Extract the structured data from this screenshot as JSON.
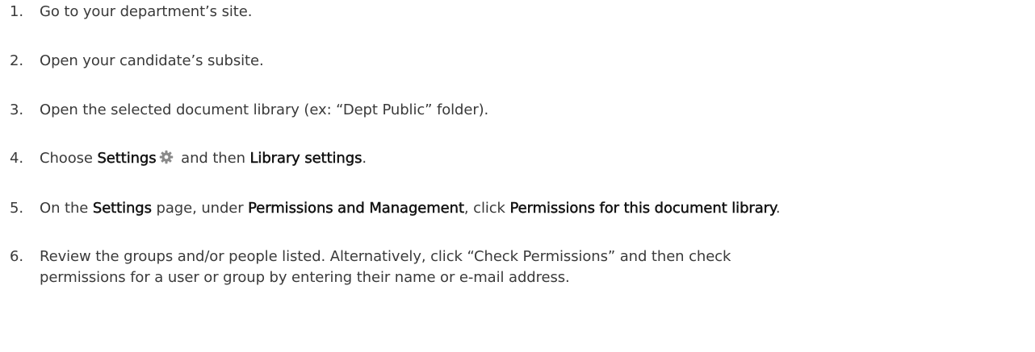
{
  "steps": [
    {
      "number": "1.",
      "text": "Go to your department’s site."
    },
    {
      "number": "2.",
      "text": "Open your candidate’s subsite."
    },
    {
      "number": "3.",
      "text": "Open the selected document library (ex: “Dept Public” folder)."
    },
    {
      "number": "4.",
      "prefix": "Choose ",
      "settings": "Settings",
      "gear_icon": "gear-icon",
      "middle": " and then ",
      "library_settings": "Library settings",
      "suffix": "."
    },
    {
      "number": "5.",
      "prefix": "On the ",
      "settings": "Settings",
      "middle1": " page, under ",
      "permissions_management": "Permissions and Management",
      "middle2": ", click ",
      "permissions_link": "Permissions for this document library",
      "suffix": "."
    },
    {
      "number": "6.",
      "line1": "Review the groups and/or people listed. Alternatively, click “Check Permissions” and then check",
      "line2": "permissions for a user or group by entering their name or e-mail address."
    }
  ],
  "colors": {
    "text": "#3a3a3a",
    "emphasis": "#111111",
    "gear": "#8a8a8a"
  }
}
